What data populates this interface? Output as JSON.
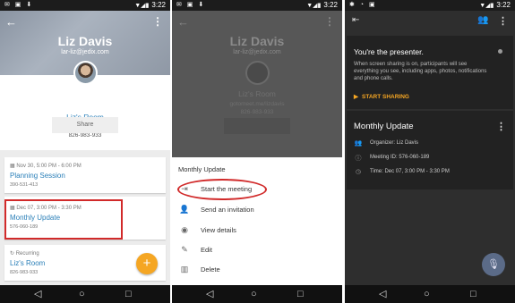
{
  "status": {
    "left_icons": "✉ ▣ ⬇",
    "p1_time": "3:22",
    "p2_time": "3:22",
    "p3_left_icons": "✱ ◔ ▣",
    "p3_time": "3:22"
  },
  "panel1": {
    "header": {
      "name": "Liz Davis",
      "email": "lar-liz@jedix.com"
    },
    "room": {
      "title": "Liz's Room",
      "url": "gotomeet.me/lizdavis",
      "phone": "826-983-933",
      "share_label": "Share"
    },
    "meetings": [
      {
        "when": "Nov 30, 5:00 PM - 6:00 PM",
        "title": "Planning Session",
        "code": "390-531-413"
      },
      {
        "when": "Dec 07, 3:00 PM - 3:30 PM",
        "title": "Monthly Update",
        "code": "576-060-189"
      },
      {
        "when": "Recurring",
        "title": "Liz's Room",
        "code": "826-983-933"
      }
    ],
    "fab_label": "+"
  },
  "panel2": {
    "dimmed": {
      "name": "Liz Davis",
      "email": "lar-liz@jedix.com",
      "room_title": "Liz's Room",
      "room_url": "gotomeet.me/lizdavis",
      "room_phone": "826-983-933"
    },
    "sheet_title": "Monthly Update",
    "items": [
      {
        "icon": "start-meeting-icon",
        "label": "Start the meeting"
      },
      {
        "icon": "add-person-icon",
        "label": "Send an invitation"
      },
      {
        "icon": "eye-icon",
        "label": "View details"
      },
      {
        "icon": "pencil-icon",
        "label": "Edit"
      },
      {
        "icon": "trash-icon",
        "label": "Delete"
      }
    ]
  },
  "panel3": {
    "presenter": {
      "title": "You're the presenter.",
      "body": "When screen sharing is on, participants will see everything you see, including apps, photos, notifications and phone calls.",
      "action": "START SHARING"
    },
    "meeting": {
      "title": "Monthly Update",
      "organizer": "Organizer: Liz Davis",
      "meeting_id": "Meeting ID: 576-060-189",
      "time": "Time: Dec 07, 3:00 PM - 3:30 PM"
    }
  },
  "colors": {
    "accent_blue": "#2a7fb8",
    "fab_orange": "#f5a623",
    "highlight_red": "#d12a2a",
    "dark_bg": "#2e2e2e"
  }
}
